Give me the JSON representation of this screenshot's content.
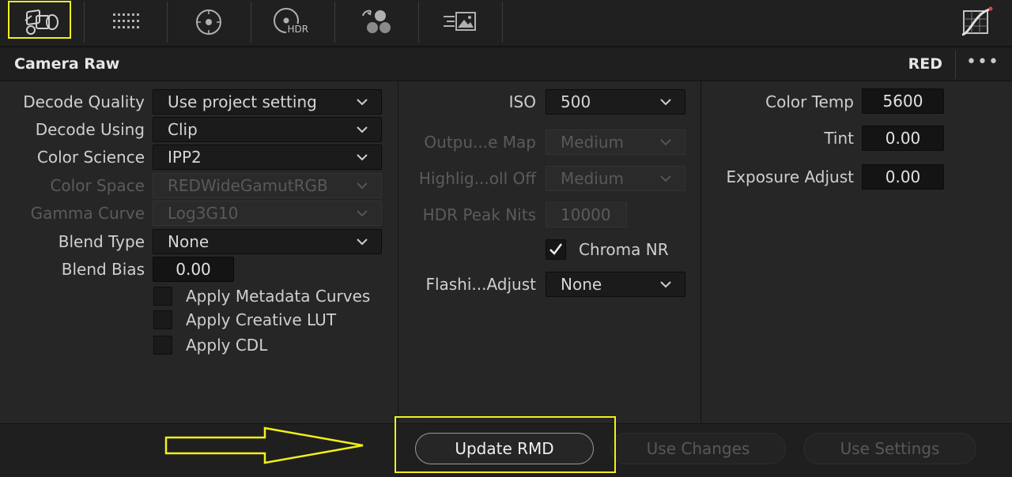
{
  "toolbar": {
    "icons": [
      "camera-raw-icon",
      "color-match-icon",
      "primaries-wheels-icon",
      "hdr-wheels-icon",
      "rgb-mixer-icon",
      "motion-effects-icon",
      "curves-icon"
    ],
    "hdr_text": "HDR",
    "highlight_color": "#f2ef1a"
  },
  "panel": {
    "title": "Camera Raw",
    "format": "RED",
    "menu_label": "•••"
  },
  "left": {
    "decode_quality": {
      "label": "Decode Quality",
      "value": "Use project setting"
    },
    "decode_using": {
      "label": "Decode Using",
      "value": "Clip"
    },
    "color_science": {
      "label": "Color Science",
      "value": "IPP2"
    },
    "color_space": {
      "label": "Color Space",
      "value": "REDWideGamutRGB"
    },
    "gamma_curve": {
      "label": "Gamma Curve",
      "value": "Log3G10"
    },
    "blend_type": {
      "label": "Blend Type",
      "value": "None"
    },
    "blend_bias": {
      "label": "Blend Bias",
      "value": "0.00"
    },
    "checkboxes": [
      {
        "label": "Apply Metadata Curves",
        "checked": false
      },
      {
        "label": "Apply Creative LUT",
        "checked": false
      },
      {
        "label": "Apply CDL",
        "checked": false
      }
    ]
  },
  "middle": {
    "iso": {
      "label": "ISO",
      "value": "500"
    },
    "output_map": {
      "label": "Outpu...e Map",
      "value": "Medium"
    },
    "highlight_rolloff": {
      "label": "Highlig...oll Off",
      "value": "Medium"
    },
    "hdr_peak_nits": {
      "label": "HDR Peak Nits",
      "value": "10000"
    },
    "chroma_nr": {
      "label": "Chroma NR",
      "checked": true
    },
    "flashing_adjust": {
      "label": "Flashi...Adjust",
      "value": "None"
    }
  },
  "right": {
    "color_temp": {
      "label": "Color Temp",
      "value": "5600"
    },
    "tint": {
      "label": "Tint",
      "value": "0.00"
    },
    "exposure_adjust": {
      "label": "Exposure Adjust",
      "value": "0.00"
    }
  },
  "footer": {
    "update_rmd": "Update RMD",
    "use_changes": "Use Changes",
    "use_settings": "Use Settings"
  }
}
